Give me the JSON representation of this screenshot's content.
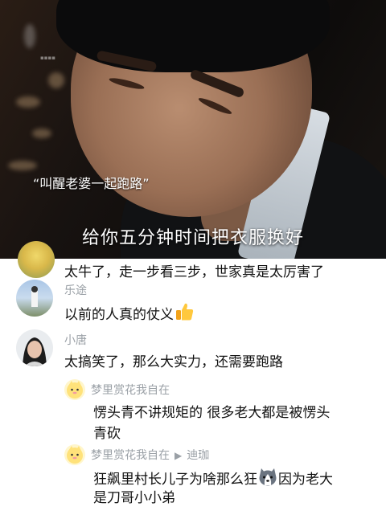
{
  "video": {
    "quote_title": "“叫醒老婆一起跑路”",
    "subtitle": "给你五分钟时间把衣服换好"
  },
  "comments": [
    {
      "text": "太牛了，走一步看三步，世家真是太厉害了"
    },
    {
      "username": "乐途",
      "text": "以前的人真的仗义",
      "emoji": "thumbs-up-icon"
    },
    {
      "username": "小唐",
      "text": "太搞笑了，那么大实力，还需要跑路",
      "replies": [
        {
          "username": "梦里赏花我自在",
          "text_line1": "愣头青不讲规矩的  很多老大都是被愣头",
          "text_line2": "青砍"
        },
        {
          "username": "梦里赏花我自在",
          "reply_to": "迪珈",
          "text_part1": "狂飙里村长儿子为啥那么狂",
          "text_part2": "因为老大",
          "text_line2": "是刀哥小小弟",
          "emoji": "husky-dog-icon"
        }
      ]
    }
  ],
  "colors": {
    "username": "#9aa0a6",
    "text": "#111111",
    "background": "#ffffff"
  }
}
